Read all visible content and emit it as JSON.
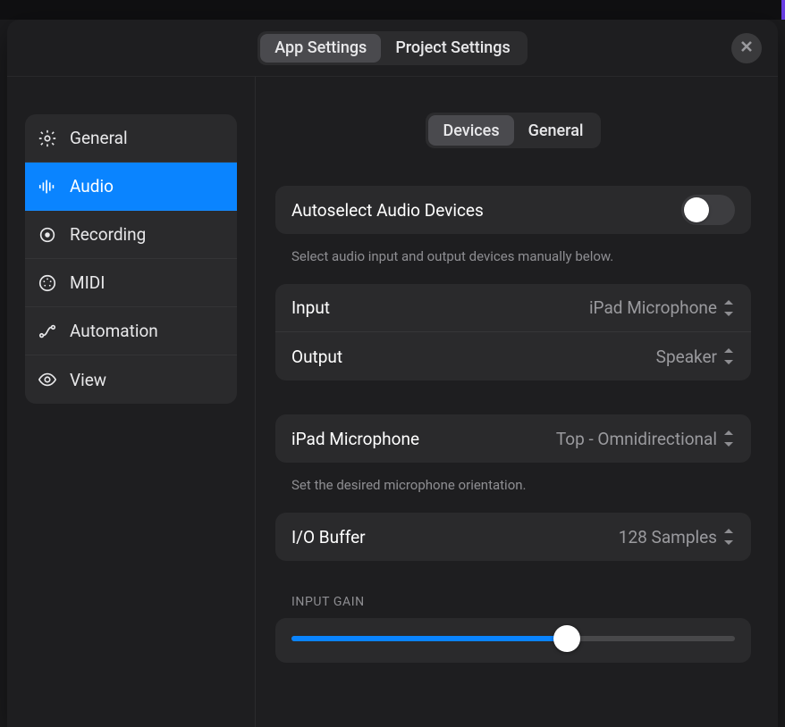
{
  "header": {
    "tabs": [
      "App Settings",
      "Project Settings"
    ],
    "active_tab": 0
  },
  "sidebar": {
    "items": [
      {
        "label": "General",
        "icon": "gear"
      },
      {
        "label": "Audio",
        "icon": "waveform"
      },
      {
        "label": "Recording",
        "icon": "record"
      },
      {
        "label": "MIDI",
        "icon": "midi"
      },
      {
        "label": "Automation",
        "icon": "curve"
      },
      {
        "label": "View",
        "icon": "eye"
      }
    ],
    "active_index": 1
  },
  "main": {
    "sub_tabs": [
      "Devices",
      "General"
    ],
    "active_sub_tab": 0,
    "autoselect": {
      "label": "Autoselect Audio Devices",
      "help": "Select audio input and output devices manually below.",
      "on": false
    },
    "io": {
      "input_label": "Input",
      "input_value": "iPad Microphone",
      "output_label": "Output",
      "output_value": "Speaker"
    },
    "mic": {
      "label": "iPad Microphone",
      "value": "Top - Omnidirectional",
      "help": "Set the desired microphone orientation."
    },
    "buffer": {
      "label": "I/O Buffer",
      "value": "128 Samples"
    },
    "gain": {
      "caption": "INPUT GAIN",
      "percent": 62
    }
  }
}
